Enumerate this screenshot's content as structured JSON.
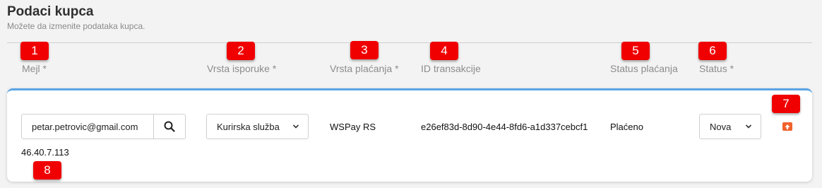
{
  "header": {
    "title": "Podaci kupca",
    "subtitle": "Možete da izmenite podataka kupca."
  },
  "columns": {
    "email": "Mejl *",
    "delivery": "Vrsta isporuke *",
    "payment_type": "Vrsta plaćanja *",
    "transaction_id": "ID transakcije",
    "payment_status": "Status plaćanja",
    "status": "Status *"
  },
  "badges": [
    "1",
    "2",
    "3",
    "4",
    "5",
    "6",
    "7",
    "8"
  ],
  "row": {
    "email": "petar.petrovic@gmail.com",
    "delivery": "Kurirska služba",
    "payment_type": "WSPay RS",
    "transaction_id": "e26ef83d-8d90-4e44-8fd6-a1d337cebcf1",
    "payment_status": "Plaćeno",
    "status": "Nova",
    "ip": "46.40.7.113"
  },
  "icons": {
    "search": "search-icon",
    "chevron": "chevron-down-icon",
    "upload": "upload-icon"
  },
  "colors": {
    "badge": "#f00000",
    "card_accent": "#5aa4e6",
    "upload_icon": "#f0622d"
  }
}
